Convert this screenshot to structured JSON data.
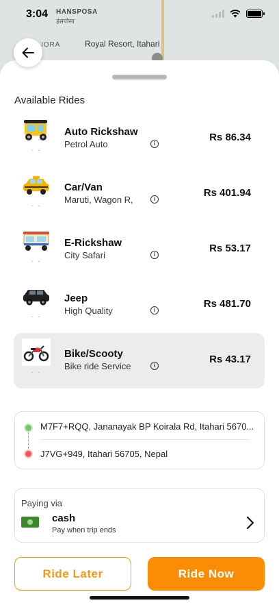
{
  "status_bar": {
    "time": "3:04"
  },
  "map": {
    "place_top": "HANSPOSA",
    "place_top_local": "हंसपोसा",
    "place_left": "IORA",
    "landmark": "Royal Resort, Itahari"
  },
  "section_title": "Available Rides",
  "rides": [
    {
      "name": "Auto Rickshaw",
      "subtitle": "Petrol Auto",
      "price": "Rs 86.34",
      "icon": "auto-rickshaw-icon",
      "dash": "- -"
    },
    {
      "name": "Car/Van",
      "subtitle": "Maruti, Wagon R,",
      "price": "Rs 401.94",
      "icon": "taxi-icon",
      "dash": "- -"
    },
    {
      "name": "E-Rickshaw",
      "subtitle": "City Safari",
      "price": "Rs 53.17",
      "icon": "e-rickshaw-icon",
      "dash": "- -"
    },
    {
      "name": "Jeep",
      "subtitle": "High Quality",
      "price": "Rs 481.70",
      "icon": "jeep-icon",
      "dash": "- -"
    },
    {
      "name": "Bike/Scooty",
      "subtitle": "Bike ride Service",
      "price": "Rs 43.17",
      "icon": "motorbike-icon",
      "dash": "- -",
      "selected": true
    }
  ],
  "info_glyph": "i",
  "route": {
    "pickup": "M7F7+RQQ, Jananayak BP Koirala Rd, Itahari 5670...",
    "dropoff": "J7VG+949, Itahari 56705, Nepal"
  },
  "payment": {
    "label": "Paying via",
    "method": "cash",
    "note": "Pay when trip ends"
  },
  "buttons": {
    "ride_later": "Ride Later",
    "ride_now": "Ride Now"
  },
  "colors": {
    "accent": "#fb8c06",
    "selected_bg": "#ececec",
    "pickup_dot": "#7cc36b",
    "dropoff_dot": "#ee5a5a"
  }
}
